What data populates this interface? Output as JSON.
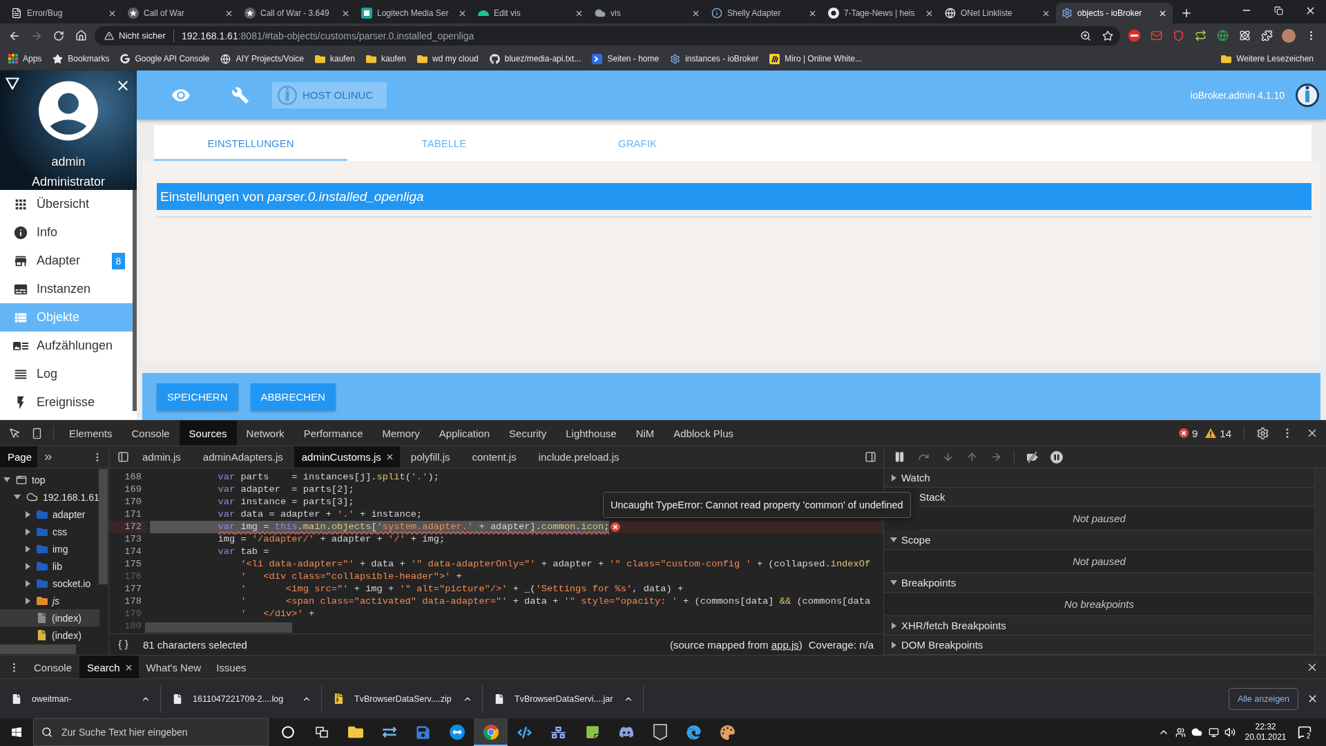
{
  "browser": {
    "tabs": [
      {
        "title": "Error/Bug",
        "kind": "page",
        "selected": false
      },
      {
        "title": "Call of War",
        "kind": "star",
        "selected": false
      },
      {
        "title": "Call of War - 3.649",
        "kind": "star",
        "selected": false
      },
      {
        "title": "Logitech Media Ser",
        "kind": "media",
        "selected": false
      },
      {
        "title": "Edit vis",
        "kind": "mint",
        "selected": false
      },
      {
        "title": "vis",
        "kind": "cloud",
        "selected": false
      },
      {
        "title": "Shelly Adapter",
        "kind": "info",
        "selected": false
      },
      {
        "title": "7-Tage-News | heis",
        "kind": "news",
        "selected": false
      },
      {
        "title": "ONet Linkliste",
        "kind": "globe",
        "selected": false
      },
      {
        "title": "objects - ioBroker",
        "kind": "gear",
        "selected": true
      }
    ],
    "address": {
      "warning": "Nicht sicher",
      "host": "192.168.1.61",
      "path": ":8081/#tab-objects/customs/parser.0.installed_openliga"
    },
    "bookmarks": [
      {
        "label": "Apps",
        "kind": "apps"
      },
      {
        "label": "Bookmarks",
        "kind": "star"
      },
      {
        "label": "Google API Console",
        "kind": "google"
      },
      {
        "label": "AIY Projects/Voice",
        "kind": "globe"
      },
      {
        "label": "kaufen",
        "kind": "folder"
      },
      {
        "label": "kaufen",
        "kind": "folder"
      },
      {
        "label": "wd my cloud",
        "kind": "folder"
      },
      {
        "label": "bluez/media-api.txt...",
        "kind": "github"
      },
      {
        "label": "Seiten - home",
        "kind": "s-logo"
      },
      {
        "label": "instances - ioBroker",
        "kind": "gear"
      },
      {
        "label": "Miro | Online White...",
        "kind": "miro"
      }
    ],
    "other_bookmarks": "Weitere Lesezeichen"
  },
  "app": {
    "user": {
      "name": "admin",
      "role": "Administrator"
    },
    "menu": [
      {
        "label": "Übersicht",
        "kind": "apps",
        "selected": false
      },
      {
        "label": "Info",
        "kind": "info",
        "selected": false
      },
      {
        "label": "Adapter",
        "kind": "store",
        "selected": false,
        "badge": "8"
      },
      {
        "label": "Instanzen",
        "kind": "subtitles",
        "selected": false
      },
      {
        "label": "Objekte",
        "kind": "list",
        "selected": true
      },
      {
        "label": "Aufzählungen",
        "kind": "art",
        "selected": false
      },
      {
        "label": "Log",
        "kind": "lines",
        "selected": false
      },
      {
        "label": "Ereignisse",
        "kind": "flash",
        "selected": false
      }
    ],
    "host_button": {
      "label": "HOST OLINUC",
      "disabled": true
    },
    "version": "ioBroker.admin 4.1.10",
    "tabs": [
      {
        "label": "EINSTELLUNGEN",
        "selected": true
      },
      {
        "label": "TABELLE",
        "selected": false
      },
      {
        "label": "GRAFIK",
        "selected": false
      }
    ],
    "panel_title": "Einstellungen von *parser.0.installed_openliga*",
    "buttons": [
      "SPEICHERN",
      "ABBRECHEN"
    ]
  },
  "devtools": {
    "panels": [
      {
        "label": "Elements",
        "selected": false
      },
      {
        "label": "Console",
        "selected": false
      },
      {
        "label": "Sources",
        "selected": true
      },
      {
        "label": "Network",
        "selected": false
      },
      {
        "label": "Performance",
        "selected": false
      },
      {
        "label": "Memory",
        "selected": false
      },
      {
        "label": "Application",
        "selected": false
      },
      {
        "label": "Security",
        "selected": false
      },
      {
        "label": "Lighthouse",
        "selected": false
      },
      {
        "label": "NiM",
        "selected": false
      },
      {
        "label": "Adblock Plus",
        "selected": false
      }
    ],
    "errors": "9",
    "warnings": "14",
    "navigator_tabs": [
      {
        "label": "Page",
        "selected": true
      }
    ],
    "tree": [
      {
        "label": "top",
        "kind": "frame",
        "expanded": true,
        "selected": false,
        "children": [
          {
            "label": "192.168.1.61",
            "kind": "cloud",
            "expanded": true,
            "selected": false,
            "children": [
              {
                "label": "adapter",
                "kind": "folder",
                "expanded": false,
                "selected": false
              },
              {
                "label": "css",
                "kind": "folder",
                "expanded": false,
                "selected": false
              },
              {
                "label": "img",
                "kind": "folder",
                "expanded": false,
                "selected": false
              },
              {
                "label": "lib",
                "kind": "folder",
                "expanded": false,
                "selected": false
              },
              {
                "label": "socket.io",
                "kind": "folder",
                "expanded": false,
                "selected": false
              },
              {
                "label": "js",
                "kind": "js-folder",
                "expanded": false,
                "selected": false
              },
              {
                "label": "(index)",
                "kind": "document",
                "selected": true
              },
              {
                "label": "(index)",
                "kind": "script",
                "selected": false
              }
            ]
          }
        ]
      }
    ],
    "files": [
      {
        "name": "admin.js",
        "selected": false
      },
      {
        "name": "adminAdapters.js",
        "selected": false
      },
      {
        "name": "adminCustoms.js",
        "selected": true
      },
      {
        "name": "polyfill.js",
        "selected": false
      },
      {
        "name": "content.js",
        "selected": false
      },
      {
        "name": "include.preload.js",
        "selected": false
      }
    ],
    "code_lines": [
      {
        "number": "168",
        "kind": "statement",
        "breakable": true,
        "selected": false,
        "error": false,
        "tokens": [
          {
            "text": "var",
            "kind": "kw"
          },
          {
            "text": " parts    = instances[j].",
            "kind": "plain"
          },
          {
            "text": "split",
            "kind": "prop"
          },
          {
            "text": "(",
            "kind": "plain"
          },
          {
            "text": "'.'",
            "kind": "str"
          },
          {
            "text": ");",
            "kind": "plain"
          }
        ]
      },
      {
        "number": "169",
        "kind": "statement",
        "breakable": true,
        "selected": false,
        "error": false,
        "tokens": [
          {
            "text": "var",
            "kind": "kw"
          },
          {
            "text": " adapter  = parts[",
            "kind": "plain"
          },
          {
            "text": "2",
            "kind": "num"
          },
          {
            "text": "];",
            "kind": "plain"
          }
        ]
      },
      {
        "number": "170",
        "kind": "statement",
        "breakable": true,
        "selected": false,
        "error": false,
        "tokens": [
          {
            "text": "var",
            "kind": "kw"
          },
          {
            "text": " instance = parts[",
            "kind": "plain"
          },
          {
            "text": "3",
            "kind": "num"
          },
          {
            "text": "];",
            "kind": "plain"
          }
        ]
      },
      {
        "number": "171",
        "kind": "statement",
        "breakable": true,
        "selected": false,
        "error": false,
        "tokens": [
          {
            "text": "var",
            "kind": "kw"
          },
          {
            "text": " data = adapter + ",
            "kind": "plain"
          },
          {
            "text": "'.'",
            "kind": "str"
          },
          {
            "text": " + instance;",
            "kind": "plain"
          }
        ]
      },
      {
        "number": "172",
        "kind": "statement",
        "breakable": true,
        "selected": true,
        "error": true,
        "tokens": [
          {
            "text": "var",
            "kind": "kw"
          },
          {
            "text": " img = ",
            "kind": "plain"
          },
          {
            "text": "this",
            "kind": "kw"
          },
          {
            "text": ".",
            "kind": "plain"
          },
          {
            "text": "main",
            "kind": "prop"
          },
          {
            "text": ".",
            "kind": "plain"
          },
          {
            "text": "objects",
            "kind": "prop"
          },
          {
            "text": "[",
            "kind": "plain"
          },
          {
            "text": "'system.adapter.'",
            "kind": "str"
          },
          {
            "text": " + adapter].",
            "kind": "plain"
          },
          {
            "text": "common",
            "kind": "prop"
          },
          {
            "text": ".",
            "kind": "plain"
          },
          {
            "text": "icon",
            "kind": "prop"
          },
          {
            "text": ";",
            "kind": "plain"
          }
        ]
      },
      {
        "number": "173",
        "kind": "statement",
        "breakable": true,
        "selected": false,
        "error": false,
        "tokens": [
          {
            "text": "img = ",
            "kind": "plain"
          },
          {
            "text": "'/adapter/'",
            "kind": "str"
          },
          {
            "text": " + adapter + ",
            "kind": "plain"
          },
          {
            "text": "'/'",
            "kind": "str"
          },
          {
            "text": " + img;",
            "kind": "plain"
          }
        ]
      },
      {
        "number": "174",
        "kind": "statement",
        "breakable": true,
        "selected": false,
        "error": false,
        "tokens": [
          {
            "text": "var",
            "kind": "kw"
          },
          {
            "text": " tab =",
            "kind": "plain"
          }
        ]
      },
      {
        "number": "175",
        "kind": "continuation",
        "breakable": true,
        "selected": false,
        "error": false,
        "tokens": [
          {
            "text": "'<li data-adapter=\"'",
            "kind": "str"
          },
          {
            "text": " + data + ",
            "kind": "plain"
          },
          {
            "text": "'\" data-adapterOnly=\"'",
            "kind": "str"
          },
          {
            "text": " + adapter + ",
            "kind": "plain"
          },
          {
            "text": "'\" class=\"custom-config '",
            "kind": "str"
          },
          {
            "text": " + (collapsed.",
            "kind": "plain"
          },
          {
            "text": "indexOf",
            "kind": "prop"
          }
        ]
      },
      {
        "number": "176",
        "kind": "continuation",
        "breakable": false,
        "selected": false,
        "error": false,
        "tokens": [
          {
            "text": "'   <div class=\"collapsible-header\">'",
            "kind": "str"
          },
          {
            "text": " +",
            "kind": "plain"
          }
        ]
      },
      {
        "number": "177",
        "kind": "continuation",
        "breakable": true,
        "selected": false,
        "error": false,
        "tokens": [
          {
            "text": "'       <img src=\"'",
            "kind": "str"
          },
          {
            "text": " + img + ",
            "kind": "plain"
          },
          {
            "text": "'\" alt=\"picture\"/>'",
            "kind": "str"
          },
          {
            "text": " + _(",
            "kind": "plain"
          },
          {
            "text": "'Settings for %s'",
            "kind": "str"
          },
          {
            "text": ", data) +",
            "kind": "plain"
          }
        ]
      },
      {
        "number": "178",
        "kind": "continuation",
        "breakable": true,
        "selected": false,
        "error": false,
        "tokens": [
          {
            "text": "'       <span class=\"activated\" data-adapter=\"'",
            "kind": "str"
          },
          {
            "text": " + data + ",
            "kind": "plain"
          },
          {
            "text": "'\" style=\"opacity: '",
            "kind": "str"
          },
          {
            "text": " + (commons[data] ",
            "kind": "plain"
          },
          {
            "text": "&&",
            "kind": "op"
          },
          {
            "text": " (commons[data",
            "kind": "plain"
          }
        ]
      },
      {
        "number": "179",
        "kind": "continuation",
        "breakable": false,
        "selected": false,
        "error": false,
        "tokens": [
          {
            "text": "'   </div>'",
            "kind": "str"
          },
          {
            "text": " +",
            "kind": "plain"
          }
        ]
      },
      {
        "number": "180",
        "breakable": false,
        "error": false
      }
    ],
    "error_tooltip": "Uncaught TypeError: Cannot read property 'common' of undefined",
    "selection_status": "81 characters selected",
    "source_map": {
      "prefix": "(source mapped from",
      "link": "app.js",
      "suffix": ")"
    },
    "coverage": "Coverage: n/a",
    "sections": [
      {
        "label": "Watch",
        "expanded": false,
        "covered": false
      },
      {
        "label": "Stack",
        "expanded": true,
        "covered": true,
        "body": "Not paused"
      },
      {
        "label": "Scope",
        "expanded": true,
        "covered": false,
        "body": "Not paused"
      },
      {
        "label": "Breakpoints",
        "expanded": true,
        "covered": false,
        "body": "No breakpoints"
      },
      {
        "label": "XHR/fetch Breakpoints",
        "expanded": false,
        "covered": false
      },
      {
        "label": "DOM Breakpoints",
        "expanded": false,
        "covered": false
      }
    ],
    "drawer_tabs": [
      {
        "label": "Console",
        "selected": false
      },
      {
        "label": "Search",
        "selected": true
      },
      {
        "label": "What's New",
        "selected": false
      },
      {
        "label": "Issues",
        "selected": false
      }
    ]
  },
  "downloads": {
    "items": [
      {
        "name": "oweitman-",
        "kind": "file"
      },
      {
        "name": "1611047221709-2....log",
        "kind": "file"
      },
      {
        "name": "TvBrowserDataServ....zip",
        "kind": "archive"
      },
      {
        "name": "TvBrowserDataServi....jar",
        "kind": "file"
      }
    ],
    "show_all": "Alle anzeigen"
  },
  "taskbar": {
    "search_placeholder": "Zur Suche Text hier eingeben",
    "apps": [
      {
        "kind": "folder",
        "selected": false
      },
      {
        "kind": "transfer",
        "selected": false
      },
      {
        "kind": "save",
        "selected": false
      },
      {
        "kind": "remote",
        "selected": false
      },
      {
        "kind": "browser",
        "selected": true
      },
      {
        "kind": "code",
        "selected": false
      },
      {
        "kind": "network",
        "selected": false
      },
      {
        "kind": "notes",
        "selected": false
      },
      {
        "kind": "chat",
        "selected": false
      },
      {
        "kind": "game",
        "selected": false
      },
      {
        "kind": "edge",
        "selected": false
      },
      {
        "kind": "palette",
        "selected": false
      }
    ],
    "time": "22:32",
    "date": "20.01.2021",
    "notifications": "2"
  }
}
